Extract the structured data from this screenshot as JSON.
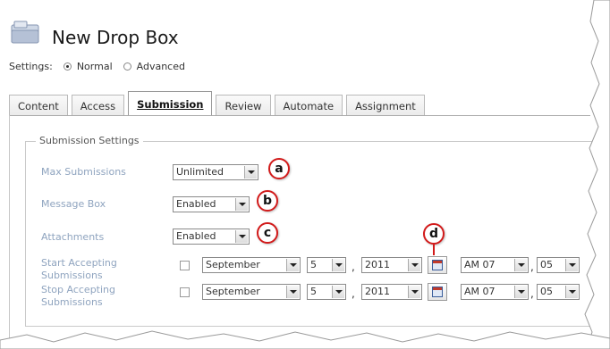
{
  "page": {
    "title": "New Drop Box",
    "settings_label": "Settings:",
    "mode_normal": "Normal",
    "mode_advanced": "Advanced"
  },
  "tabs": [
    {
      "label": "Content",
      "active": false
    },
    {
      "label": "Access",
      "active": false
    },
    {
      "label": "Submission",
      "active": true
    },
    {
      "label": "Review",
      "active": false
    },
    {
      "label": "Automate",
      "active": false
    },
    {
      "label": "Assignment",
      "active": false
    }
  ],
  "submission_settings": {
    "legend": "Submission Settings",
    "max_submissions": {
      "label": "Max Submissions",
      "value": "Unlimited"
    },
    "message_box": {
      "label": "Message Box",
      "value": "Enabled"
    },
    "attachments": {
      "label": "Attachments",
      "value": "Enabled"
    },
    "start_accepting": {
      "label_line1": "Start Accepting",
      "label_line2": "Submissions",
      "month": "September",
      "day": "5",
      "year": "2011",
      "ampm_hour": "AM 07",
      "minute": "05"
    },
    "stop_accepting": {
      "label_line1": "Stop Accepting",
      "label_line2": "Submissions",
      "month": "September",
      "day": "5",
      "year": "2011",
      "ampm_hour": "AM 07",
      "minute": "05"
    },
    "comma": ","
  },
  "callouts": {
    "a": "a",
    "b": "b",
    "c": "c",
    "d": "d"
  },
  "colors": {
    "callout": "#d21a1a",
    "label": "#8fa4bf"
  },
  "icons": {
    "drop_box": "drop-box-icon",
    "calendar": "calendar-icon"
  }
}
